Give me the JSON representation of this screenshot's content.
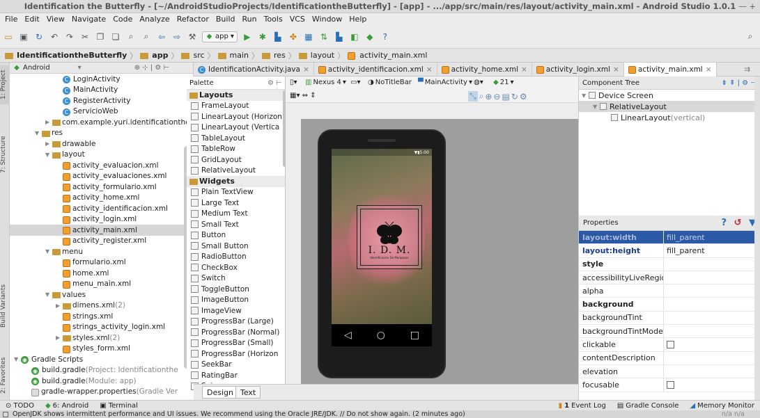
{
  "window": {
    "title": "Identification the Butterfly - [~/AndroidStudioProjects/IdentificationtheButterfly] - [app] - .../app/src/main/res/layout/activity_main.xml - Android Studio 1.0.1",
    "controls": "— +"
  },
  "menu": [
    "File",
    "Edit",
    "View",
    "Navigate",
    "Code",
    "Analyze",
    "Refactor",
    "Build",
    "Run",
    "Tools",
    "VCS",
    "Window",
    "Help"
  ],
  "toolbar": {
    "app_dropdown": "app"
  },
  "breadcrumb": [
    "IdentificationtheButterfly",
    "app",
    "src",
    "main",
    "res",
    "layout",
    "activity_main.xml"
  ],
  "project": {
    "header": "Android",
    "items": [
      {
        "label": "LoginActivity",
        "kind": "class",
        "indent": 4
      },
      {
        "label": "MainActivity",
        "kind": "class",
        "indent": 4
      },
      {
        "label": "RegisterActivity",
        "kind": "class",
        "indent": 4
      },
      {
        "label": "ServicioWeb",
        "kind": "class",
        "indent": 4
      },
      {
        "label": "com.example.yuri.identificationthel",
        "kind": "pkg",
        "indent": 3,
        "arrow": "▶"
      },
      {
        "label": "res",
        "kind": "folder",
        "indent": 2,
        "arrow": "▼"
      },
      {
        "label": "drawable",
        "kind": "folder",
        "indent": 3,
        "arrow": "▶"
      },
      {
        "label": "layout",
        "kind": "folder",
        "indent": 3,
        "arrow": "▼"
      },
      {
        "label": "activity_evaluacion.xml",
        "kind": "xml",
        "indent": 4
      },
      {
        "label": "activity_evaluaciones.xml",
        "kind": "xml",
        "indent": 4
      },
      {
        "label": "activity_formulario.xml",
        "kind": "xml",
        "indent": 4
      },
      {
        "label": "activity_home.xml",
        "kind": "xml",
        "indent": 4
      },
      {
        "label": "activity_identificacion.xml",
        "kind": "xml",
        "indent": 4
      },
      {
        "label": "activity_login.xml",
        "kind": "xml",
        "indent": 4
      },
      {
        "label": "activity_main.xml",
        "kind": "xml",
        "indent": 4,
        "selected": true
      },
      {
        "label": "activity_register.xml",
        "kind": "xml",
        "indent": 4
      },
      {
        "label": "menu",
        "kind": "folder",
        "indent": 3,
        "arrow": "▼"
      },
      {
        "label": "formulario.xml",
        "kind": "xml",
        "indent": 4
      },
      {
        "label": "home.xml",
        "kind": "xml",
        "indent": 4
      },
      {
        "label": "menu_main.xml",
        "kind": "xml",
        "indent": 4
      },
      {
        "label": "values",
        "kind": "folder",
        "indent": 3,
        "arrow": "▼"
      },
      {
        "label": "dimens.xml",
        "suffix": " (2)",
        "kind": "folder",
        "indent": 4,
        "arrow": "▶"
      },
      {
        "label": "strings.xml",
        "kind": "xml",
        "indent": 4
      },
      {
        "label": "strings_activity_login.xml",
        "kind": "xml",
        "indent": 4
      },
      {
        "label": "styles.xml",
        "suffix": " (2)",
        "kind": "folder",
        "indent": 4,
        "arrow": "▶"
      },
      {
        "label": "styles_form.xml",
        "kind": "xml",
        "indent": 4
      },
      {
        "label": "Gradle Scripts",
        "kind": "gradle",
        "indent": 0,
        "arrow": "▼"
      },
      {
        "label": "build.gradle",
        "suffix": " (Project: Identificationthe",
        "kind": "gradle",
        "indent": 1
      },
      {
        "label": "build.gradle",
        "suffix": " (Module: app)",
        "kind": "gradle",
        "indent": 1
      },
      {
        "label": "gradle-wrapper.properties",
        "suffix": " (Gradle Ver",
        "kind": "file",
        "indent": 1
      }
    ]
  },
  "left_tabs": {
    "project": "1: Project",
    "structure": "7: Structure",
    "build_variants": "Build Variants",
    "favorites": "2: Favorites"
  },
  "editor_tabs": [
    {
      "label": "IdentificationActivity.java",
      "kind": "class"
    },
    {
      "label": "activity_identificacion.xml",
      "kind": "xml"
    },
    {
      "label": "activity_home.xml",
      "kind": "xml"
    },
    {
      "label": "activity_login.xml",
      "kind": "xml"
    },
    {
      "label": "activity_main.xml",
      "kind": "xml",
      "active": true
    }
  ],
  "palette": {
    "title": "Palette",
    "groups": [
      {
        "name": "Layouts",
        "items": [
          "FrameLayout",
          "LinearLayout (Horizon",
          "LinearLayout (Vertica",
          "TableLayout",
          "TableRow",
          "GridLayout",
          "RelativeLayout"
        ]
      },
      {
        "name": "Widgets",
        "items": [
          "Plain TextView",
          "Large Text",
          "Medium Text",
          "Small Text",
          "Button",
          "Small Button",
          "RadioButton",
          "CheckBox",
          "Switch",
          "ToggleButton",
          "ImageButton",
          "ImageView",
          "ProgressBar (Large)",
          "ProgressBar (Normal)",
          "ProgressBar (Small)",
          "ProgressBar (Horizon",
          "SeekBar",
          "RatingBar",
          "Spinner"
        ]
      }
    ]
  },
  "design_toolbar": {
    "device": "Nexus 4",
    "theme": "NoTitleBar",
    "activity": "MainActivity",
    "api": "21"
  },
  "phone": {
    "status": "5:00",
    "logo_title": "I. D. M.",
    "logo_subtitle": "Identificación De Mariposas",
    "nav": [
      "◁",
      "○",
      "□"
    ]
  },
  "design_tabs": [
    "Design",
    "Text"
  ],
  "component_tree": {
    "title": "Component Tree",
    "items": [
      {
        "label": "Device Screen",
        "indent": 0
      },
      {
        "label": "RelativeLayout",
        "indent": 1,
        "selected": true
      },
      {
        "label": "LinearLayout",
        "suffix": " (vertical)",
        "indent": 2
      }
    ]
  },
  "properties": {
    "title": "Properties",
    "rows": [
      {
        "key": "layout:width",
        "value": "fill_parent",
        "style": "sel"
      },
      {
        "key": "layout:height",
        "value": "fill_parent",
        "style": "blue"
      },
      {
        "key": "style",
        "value": "",
        "style": "b"
      },
      {
        "key": "accessibilityLiveRegic",
        "value": ""
      },
      {
        "key": "alpha",
        "value": ""
      },
      {
        "key": "background",
        "value": "",
        "style": "b"
      },
      {
        "key": "backgroundTint",
        "value": ""
      },
      {
        "key": "backgroundTintMode",
        "value": ""
      },
      {
        "key": "clickable",
        "value": "",
        "checkbox": true
      },
      {
        "key": "contentDescription",
        "value": ""
      },
      {
        "key": "elevation",
        "value": ""
      },
      {
        "key": "focusable",
        "value": "",
        "checkbox": true
      }
    ]
  },
  "bottom_tools": {
    "todo": "TODO",
    "android": "6: Android",
    "terminal": "Terminal",
    "event_log": "Event Log",
    "event_count": "1",
    "gradle_console": "Gradle Console",
    "memory_monitor": "Memory Monitor"
  },
  "status": {
    "message": "OpenJDK shows intermittent performance and UI issues. We recommend using the Oracle JRE/JDK. // Do not show again. (2 minutes ago)",
    "right": "n/a   n/a"
  }
}
